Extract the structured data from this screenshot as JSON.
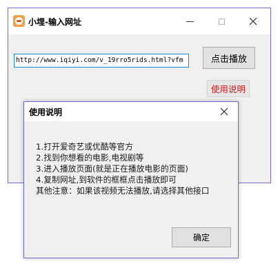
{
  "main_window": {
    "title": "小埋-输入网址",
    "url_value": "http://www.iqiyi.com/v_19rro5rids.html?vfm",
    "play_button": "点击播放",
    "help_button": "使用说明"
  },
  "dialog": {
    "title": "使用说明",
    "lines": [
      "1.打开爱奇艺或优酷等官方",
      "2.找到你想看的电影,电视剧等",
      "3.进入播放页面(就是正在播放电影的页面)",
      "4.复制网址,到软件的框框点击播放即可",
      "其他注意：如果该视频无法播放,请选择其他接口"
    ],
    "ok_button": "确定"
  },
  "colors": {
    "window_border": "#6b6bd0",
    "input_focus_border": "#1a8ad0",
    "help_text": "#d01818",
    "window_background": "#f0f0f0"
  },
  "icons": {
    "app": "app-mascot-icon",
    "minimize": "minimize-icon",
    "maximize": "maximize-icon",
    "close": "close-icon"
  }
}
